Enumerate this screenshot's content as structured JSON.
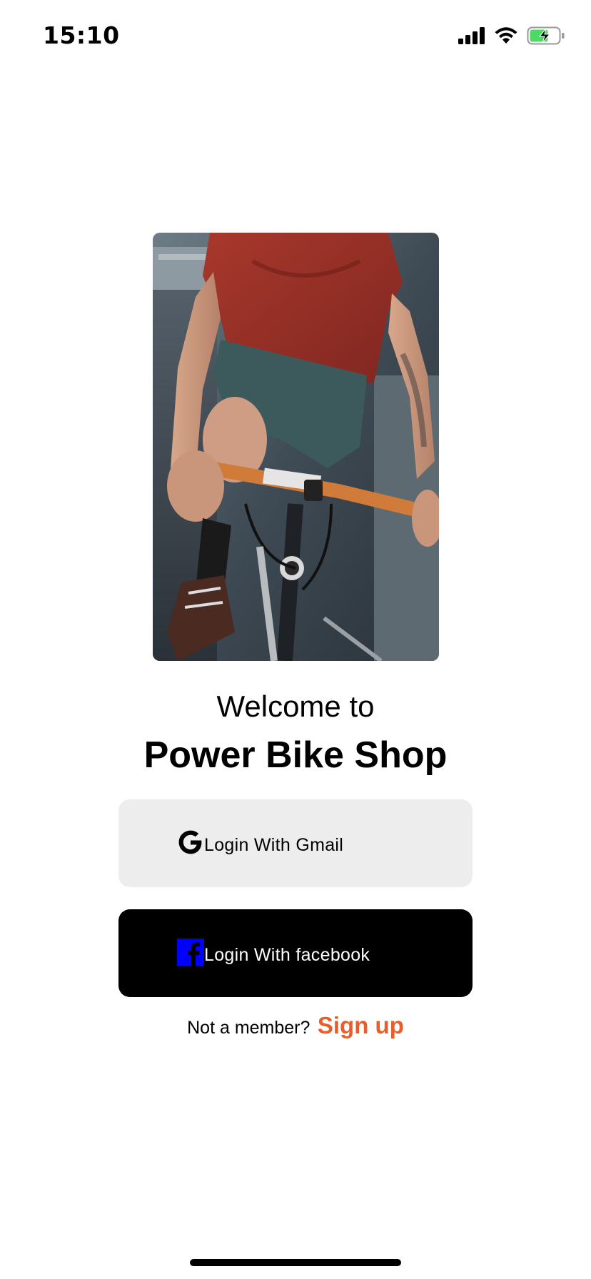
{
  "status_bar": {
    "time": "15:10",
    "icons": [
      "cellular-signal-icon",
      "wifi-icon",
      "battery-charging-icon"
    ],
    "battery_color": "#4cd964"
  },
  "hero": {
    "icon": "cyclist-photo"
  },
  "welcome": {
    "line1": "Welcome to",
    "shop_name": "Power Bike Shop"
  },
  "buttons": {
    "gmail": {
      "label": "Login With Gmail",
      "icon": "google-icon",
      "background": "#ededed"
    },
    "facebook": {
      "label": "Login With facebook",
      "icon": "facebook-icon",
      "background": "#000000",
      "icon_color": "#0000ff"
    }
  },
  "signup": {
    "prompt": "Not a member?",
    "link": "Sign up",
    "link_color": "#e85d2a"
  }
}
